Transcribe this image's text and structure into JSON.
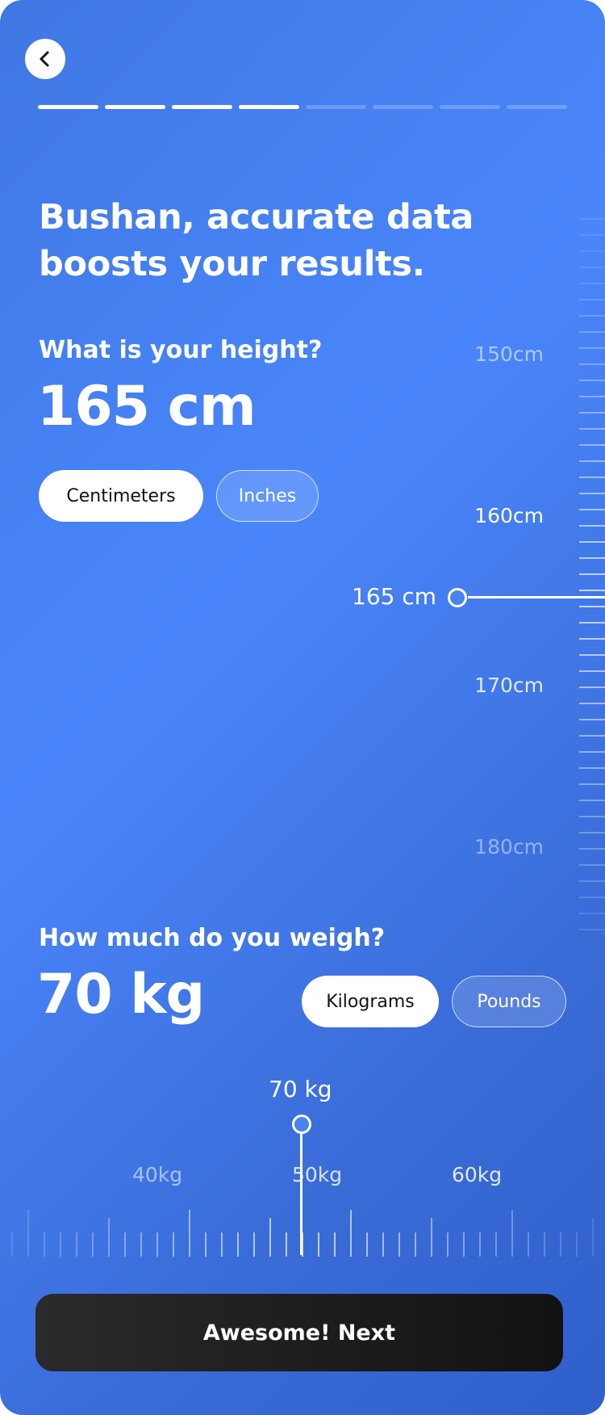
{
  "progress": {
    "total_steps": 8,
    "completed_steps": 4
  },
  "headline": "Bushan, accurate data boosts your results.",
  "height": {
    "question": "What is your height?",
    "value": "165 cm",
    "units": {
      "active": "Centimeters",
      "inactive": "Inches"
    },
    "indicator": "165 cm",
    "scale_labels": [
      "150cm",
      "160cm",
      "170cm",
      "180cm"
    ]
  },
  "weight": {
    "question": "How much do you weigh?",
    "value": "70 kg",
    "units": {
      "active": "Kilograms",
      "inactive": "Pounds"
    },
    "indicator": "70 kg",
    "scale_labels": [
      "40kg",
      "50kg",
      "60kg"
    ]
  },
  "next_button": "Awesome! Next"
}
